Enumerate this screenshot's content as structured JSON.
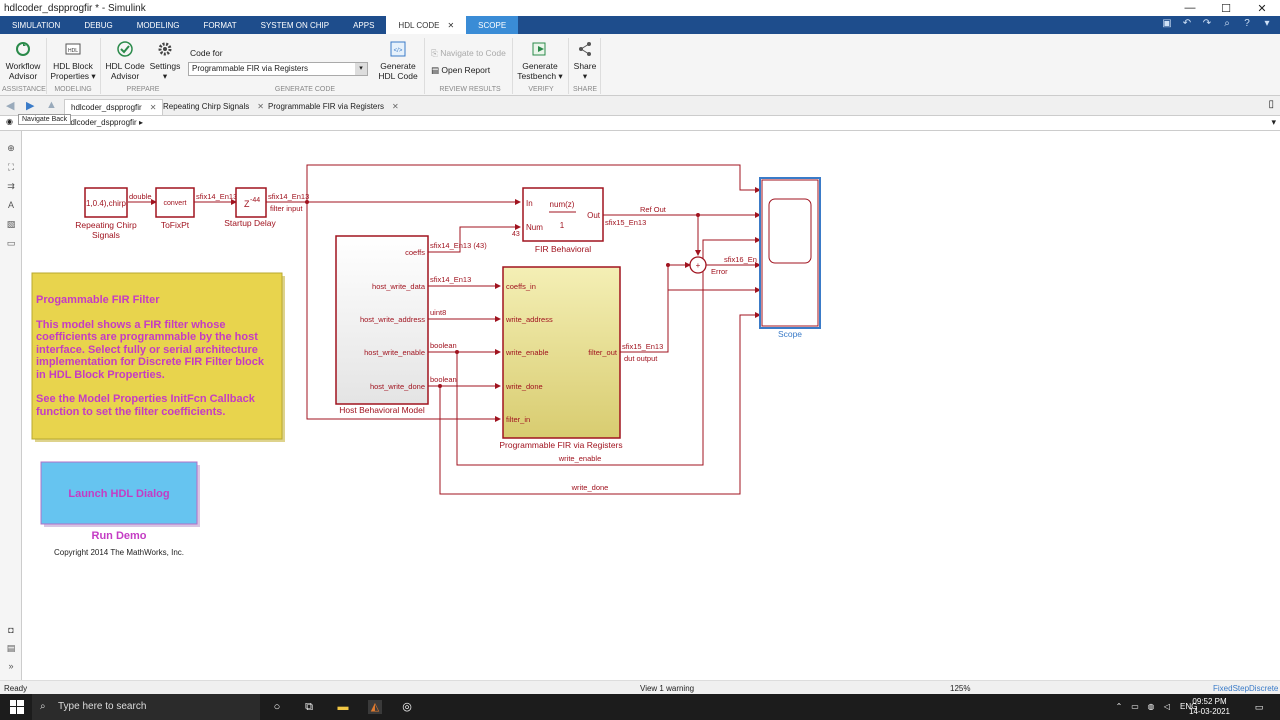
{
  "window": {
    "title": "hdlcoder_dspprogfir * - Simulink"
  },
  "tabs": [
    "SIMULATION",
    "DEBUG",
    "MODELING",
    "FORMAT",
    "SYSTEM ON CHIP",
    "APPS",
    "HDL CODE",
    "SCOPE"
  ],
  "ribbon": {
    "workflow_advisor": "Workflow Advisor",
    "workflow_advisor_l1": "Workflow",
    "workflow_advisor_l2": "Advisor",
    "hdl_block_l1": "HDL Block",
    "hdl_block_l2": "Properties ▾",
    "hdl_code_advisor_l1": "HDL Code",
    "hdl_code_advisor_l2": "Advisor",
    "settings_l1": "Settings",
    "settings_l2": "▾",
    "code_for_label": "Code for",
    "code_for_value": "Programmable FIR via Registers",
    "generate_hdl_l1": "Generate",
    "generate_hdl_l2": "HDL Code",
    "navigate_to_code": "Navigate to Code",
    "open_report": "Open Report",
    "generate_tb_l1": "Generate",
    "generate_tb_l2": "Testbench ▾",
    "share_l1": "Share",
    "share_l2": "▾",
    "groups": [
      "ASSISTANCE",
      "MODELING",
      "PREPARE",
      "GENERATE CODE",
      "REVIEW RESULTS",
      "VERIFY",
      "SHARE"
    ]
  },
  "model_tabs": [
    {
      "label": "hdlcoder_dspprogfir",
      "active": true
    },
    {
      "label": "Repeating Chirp Signals",
      "active": false
    },
    {
      "label": "Programmable FIR via Registers",
      "active": false
    }
  ],
  "tooltip": "Navigate Back",
  "breadcrumb": "hdlcoder_dspprogfir",
  "diagram": {
    "chirp_block": "1,0.4),chirp",
    "chirp_label1": "Repeating Chirp",
    "chirp_label2": "Signals",
    "double": "double",
    "convert": "convert",
    "tofixpt": "ToFixPt",
    "sfix14_1": "sfix14_En13",
    "delay_block": "Z",
    "delay_exp": "-44",
    "startup_delay": "Startup Delay",
    "sfix14_2": "sfix14_En13",
    "filter_input": "filter input",
    "fir_in": "In",
    "fir_num": "Num",
    "fir_out": "Out",
    "fir_numz": "num(z)",
    "fir_one": "1",
    "fir_43": "43",
    "fir_behavioral": "FIR Behavioral",
    "ref_out": "Ref Out",
    "sfix15_1": "sfix15_En13",
    "sfix16": "sfix16_En",
    "error": "Error",
    "scope": "Scope",
    "coeffs": "coeffs",
    "sfix14_43": "sfix14_En13 (43)",
    "host_write_data": "host_write_data",
    "host_write_address": "host_write_address",
    "host_write_enable": "host_write_enable",
    "host_write_done": "host_write_done",
    "host_model": "Host Behavioral Model",
    "sig_sfix14": "sfix14_En13",
    "sig_uint8": "uint8",
    "sig_bool1": "boolean",
    "sig_bool2": "boolean",
    "coeffs_in": "coeffs_in",
    "write_address": "write_address",
    "write_enable": "write_enable",
    "write_done": "write_done",
    "filter_in": "filter_in",
    "filter_out": "filter_out",
    "prog_fir": "Programmable FIR via Registers",
    "sfix15_2": "sfix15_En13",
    "dut_output": "dut output",
    "wl_write_enable": "write_enable",
    "wl_write_done": "write_done",
    "note_title": "Progammable FIR Filter",
    "note_body": "This model shows a FIR filter whose coefficients are programmable by the host interface. Select fully or serial architecture implementation for Discrete FIR Filter block in HDL Block Properties.",
    "note_body2": "See the Model Properties InitFcn Callback function to set the filter coefficients.",
    "launch_button": "Launch HDL Dialog",
    "run_demo": "Run Demo",
    "copyright": "Copyright 2014 The MathWorks, Inc."
  },
  "status": {
    "ready": "Ready",
    "warning": "View 1 warning",
    "zoom": "125%",
    "solver": "FixedStepDiscrete"
  },
  "taskbar": {
    "search_placeholder": "Type here to search",
    "lang": "ENG",
    "time": "09:52 PM",
    "date": "14-03-2021"
  },
  "colors": {
    "signal": "#a0131f",
    "tab_bar": "#1e4d8c",
    "note_bg": "#e8d44d",
    "note_text": "#c43cc4",
    "button_bg": "#66c4f0",
    "fir_block": "#f2eca8"
  }
}
